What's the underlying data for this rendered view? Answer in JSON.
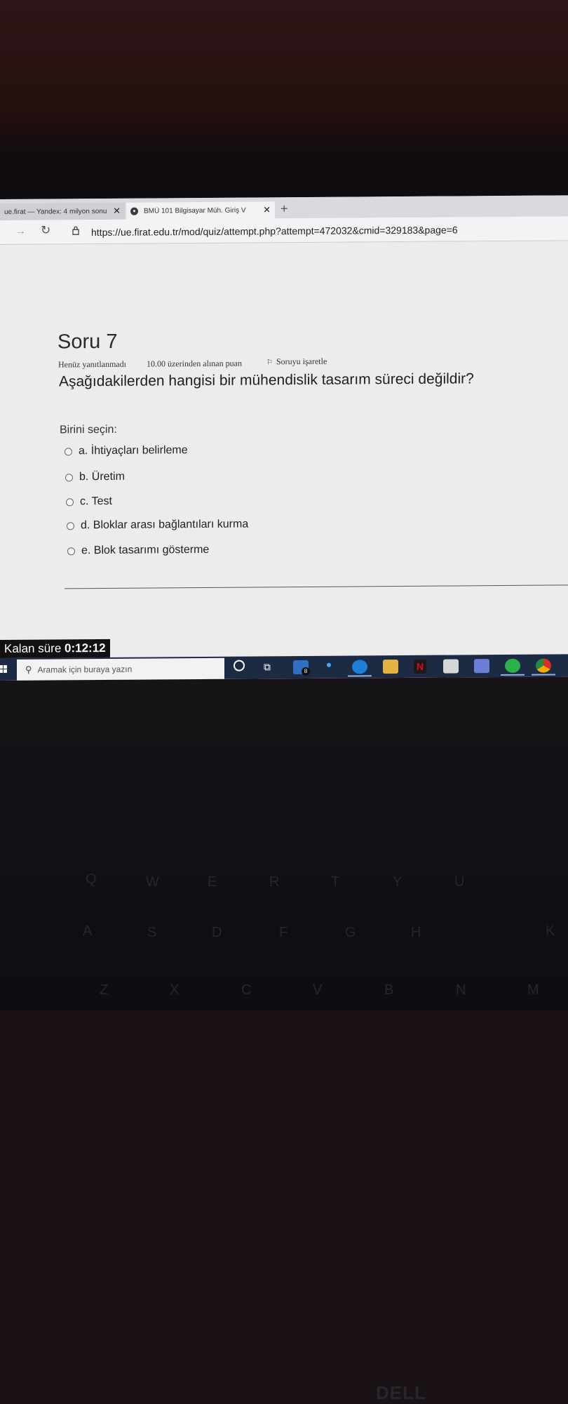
{
  "browser": {
    "tabs": [
      {
        "title": "ue.firat — Yandex: 4 milyon sonu",
        "close": "✕",
        "active": false
      },
      {
        "title": "BMÜ 101 Bilgisayar Müh. Giriş V",
        "close": "✕",
        "active": true
      }
    ],
    "new_tab": "+",
    "url": "https://ue.firat.edu.tr/mod/quiz/attempt.php?attempt=472032&cmid=329183&page=6"
  },
  "quiz": {
    "question_title": "Soru 7",
    "status": "Henüz yanıtlanmadı",
    "points": "10.00 üzerinden alınan puan",
    "flag_label": "Soruyu işaretle",
    "question_text": "Aşağıdakilerden hangisi bir mühendislik tasarım süreci değildir?",
    "choose_label": "Birini seçin:",
    "options": [
      {
        "label": "a. İhtiyaçları belirleme"
      },
      {
        "label": "b. Üretim"
      },
      {
        "label": "c. Test"
      },
      {
        "label": "d. Bloklar arası bağlantıları kurma"
      },
      {
        "label": "e. Blok tasarımı gösterme"
      }
    ]
  },
  "timer": {
    "label": "Kalan süre",
    "value": "0:12:12"
  },
  "taskbar": {
    "search_placeholder": "Aramak için buraya yazın",
    "mail_badge": "8",
    "icons": [
      "windows-icon",
      "cortana-icon",
      "task-view-icon",
      "mail-icon",
      "edge-icon",
      "file-explorer-icon",
      "netflix-icon",
      "store-icon",
      "discord-icon",
      "whatsapp-icon",
      "chrome-icon"
    ]
  },
  "laptop": {
    "brand": "DELL"
  },
  "colors": {
    "taskbar": "#1d2a44",
    "timer_bg": "#111111",
    "screen_bg": "#ececed"
  }
}
